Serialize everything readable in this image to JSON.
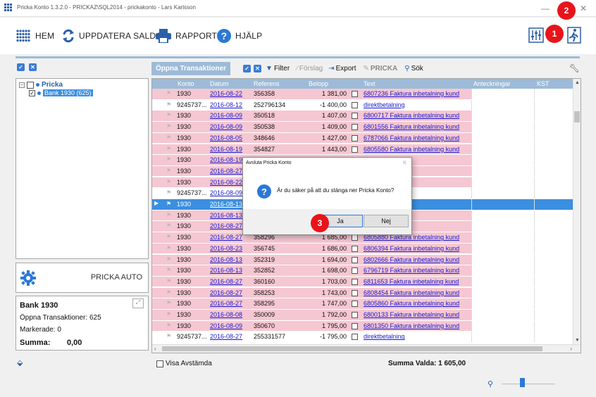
{
  "window": {
    "title": "Pricka Konto 1.3.2.0 - PRICKAZ\\SQL2014 - prickakonto - Lars Karlsson",
    "minimize": "—",
    "close": "✕"
  },
  "toolbar": {
    "home": "HEM",
    "update_balance": "UPPDATERA SALDO",
    "report": "RAPPORT",
    "help": "HJÄLP"
  },
  "callouts": {
    "c1": "1",
    "c2": "2",
    "c3": "3"
  },
  "filterbar": {
    "tab": "Öppna Transaktioner",
    "filter": "Filter",
    "suggestion": "Förslag",
    "export": "Export",
    "pricka": "PRICKA",
    "search": "Sök"
  },
  "tree": {
    "root": "Pricka",
    "child": "Bank 1930 (625)"
  },
  "auto": {
    "label": "PRICKA AUTO"
  },
  "bank": {
    "title": "Bank 1930",
    "open_tx": "Öppna Transaktioner: 625",
    "marked": "Markerade: 0",
    "sum_label": "Summa:",
    "sum_value": "0,00"
  },
  "grid": {
    "columns": [
      "Konto",
      "Datum",
      "Referens",
      "Belopp",
      "Text",
      "Anteckningar",
      "KST"
    ],
    "rows": [
      {
        "konto": "1930",
        "datum": "2016-08-22",
        "ref": "356358",
        "belopp": "1 381,00",
        "text": "6807236 Faktura inbetalning kund",
        "style": "pink"
      },
      {
        "konto": "9245737...",
        "datum": "2016-08-12",
        "ref": "252796134",
        "belopp": "-1 400,00",
        "text": "direktbetalning",
        "style": "white"
      },
      {
        "konto": "1930",
        "datum": "2016-08-09",
        "ref": "350518",
        "belopp": "1 407,00",
        "text": "6800717 Faktura inbetalning kund",
        "style": "pink"
      },
      {
        "konto": "1930",
        "datum": "2016-08-09",
        "ref": "350538",
        "belopp": "1 409,00",
        "text": "6801556 Faktura inbetalning kund",
        "style": "pink"
      },
      {
        "konto": "1930",
        "datum": "2016-08-05",
        "ref": "348646",
        "belopp": "1 427,00",
        "text": "6787066 Faktura inbetalning kund",
        "style": "pink"
      },
      {
        "konto": "1930",
        "datum": "2016-08-19",
        "ref": "354827",
        "belopp": "1 443,00",
        "text": "6805580 Faktura inbetalning kund",
        "style": "pink"
      },
      {
        "konto": "1930",
        "datum": "2016-08-19",
        "ref": "",
        "belopp": "",
        "text": "betalning kund",
        "style": "pink"
      },
      {
        "konto": "1930",
        "datum": "2016-08-27",
        "ref": "",
        "belopp": "",
        "text": "betalning kund",
        "style": "pink"
      },
      {
        "konto": "1930",
        "datum": "2016-08-22",
        "ref": "",
        "belopp": "",
        "text": "betalning kund",
        "style": "pink"
      },
      {
        "konto": "9245737...",
        "datum": "2016-08-09",
        "ref": "",
        "belopp": "",
        "text": "",
        "style": "white"
      },
      {
        "konto": "1930",
        "datum": "2016-08-13",
        "ref": "",
        "belopp": "",
        "text": "betalning kund",
        "style": "sel"
      },
      {
        "konto": "1930",
        "datum": "2016-08-13",
        "ref": "",
        "belopp": "",
        "text": "betalning kund",
        "style": "pink"
      },
      {
        "konto": "1930",
        "datum": "2016-08-27",
        "ref": "",
        "belopp": "",
        "text": "betalning kund",
        "style": "pink"
      },
      {
        "konto": "1930",
        "datum": "2016-08-27",
        "ref": "358296",
        "belopp": "1 685,00",
        "text": "6805880 Faktura inbetalning kund",
        "style": "pink"
      },
      {
        "konto": "1930",
        "datum": "2016-08-23",
        "ref": "356745",
        "belopp": "1 686,00",
        "text": "6806394 Faktura inbetalning kund",
        "style": "pink"
      },
      {
        "konto": "1930",
        "datum": "2016-08-13",
        "ref": "352319",
        "belopp": "1 694,00",
        "text": "6802666 Faktura inbetalning kund",
        "style": "pink"
      },
      {
        "konto": "1930",
        "datum": "2016-08-13",
        "ref": "352852",
        "belopp": "1 698,00",
        "text": "6796719 Faktura inbetalning kund",
        "style": "pink"
      },
      {
        "konto": "1930",
        "datum": "2016-08-27",
        "ref": "360160",
        "belopp": "1 703,00",
        "text": "6811653 Faktura inbetalning kund",
        "style": "pink"
      },
      {
        "konto": "1930",
        "datum": "2016-08-27",
        "ref": "358253",
        "belopp": "1 743,00",
        "text": "6808454 Faktura inbetalning kund",
        "style": "pink"
      },
      {
        "konto": "1930",
        "datum": "2016-08-27",
        "ref": "358295",
        "belopp": "1 747,00",
        "text": "6805860 Faktura inbetalning kund",
        "style": "pink"
      },
      {
        "konto": "1930",
        "datum": "2016-08-08",
        "ref": "350009",
        "belopp": "1 792,00",
        "text": "6800133 Faktura inbetalning kund",
        "style": "pink"
      },
      {
        "konto": "1930",
        "datum": "2016-08-09",
        "ref": "350670",
        "belopp": "1 795,00",
        "text": "6801350 Faktura inbetalning kund",
        "style": "pink"
      },
      {
        "konto": "9245737...",
        "datum": "2016-08-27",
        "ref": "255331577",
        "belopp": "-1 795,00",
        "text": "direktbetalning",
        "style": "white"
      }
    ]
  },
  "dialog": {
    "title": "Avsluta Pricka Konto",
    "close": "✕",
    "message": "Är du säker på att du stänga ner Pricka Konto?",
    "yes": "Ja",
    "no": "Nej"
  },
  "bottom": {
    "show_reconciled": "Visa Avstämda",
    "sum_selected": "Summa Valda:  1 605,00"
  }
}
